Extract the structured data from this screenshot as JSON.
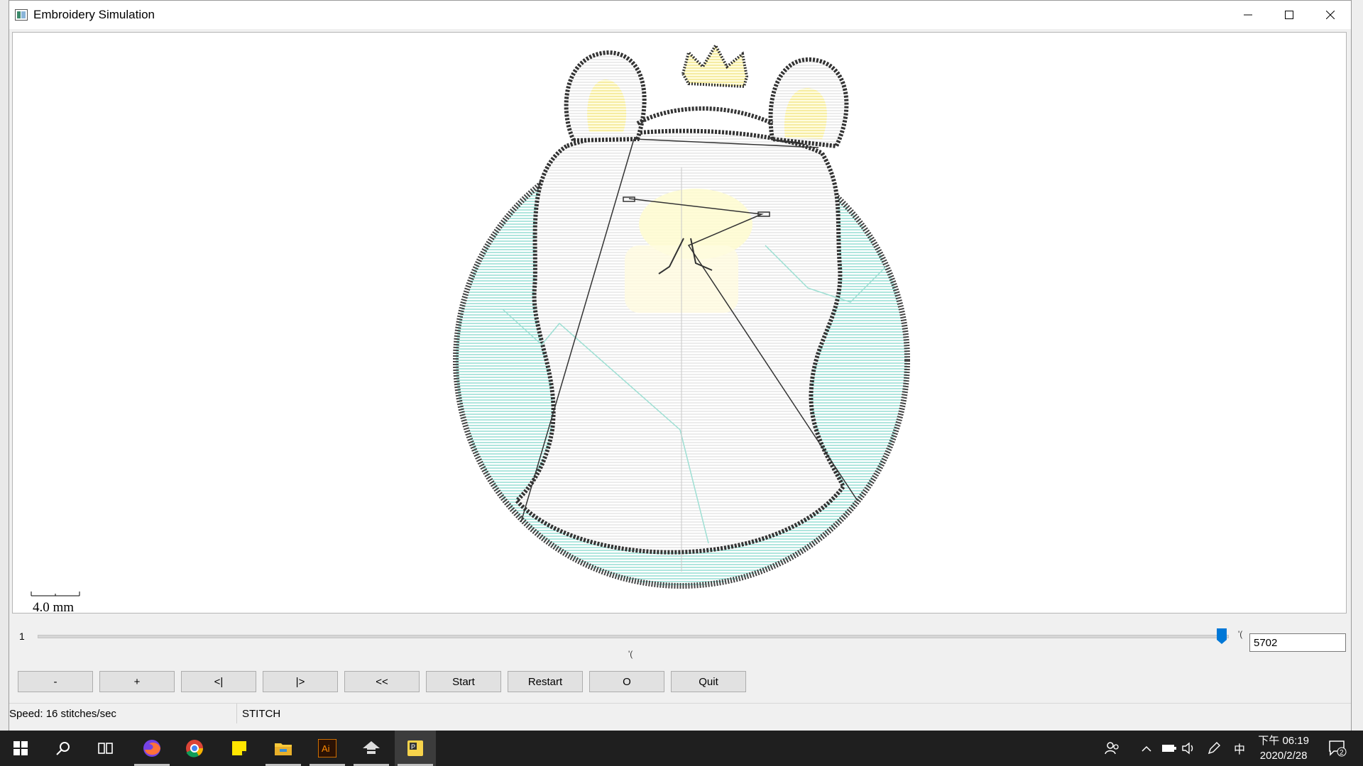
{
  "window": {
    "title": "Embroidery Simulation"
  },
  "canvas": {
    "scale_label": "4.0 mm"
  },
  "slider": {
    "min_label": "1",
    "tick_label": "'(",
    "current_stitch": "5702"
  },
  "controls": {
    "buttons": [
      "-",
      "+",
      "<|",
      "|>",
      "<<",
      "Start",
      "Restart",
      "O",
      "Quit"
    ]
  },
  "status": {
    "speed": "Speed: 16 stitches/sec",
    "mode": "STITCH"
  },
  "taskbar": {
    "time": "下午 06:19",
    "date": "2020/2/28",
    "notification_count": "2",
    "ime": "中",
    "apps": [
      "start-icon",
      "search-icon",
      "task-view-icon",
      "firefox-icon",
      "chrome-icon",
      "sticky-notes-icon",
      "file-explorer-icon",
      "illustrator-icon",
      "inkscape-icon",
      "python-icon"
    ]
  },
  "colors": {
    "fill_cyan": "#6fd8c8",
    "fill_white": "#f4f4f4",
    "fill_yellow": "#f5e86a",
    "outline": "#333333",
    "taskbar": "#1f1f1f"
  }
}
